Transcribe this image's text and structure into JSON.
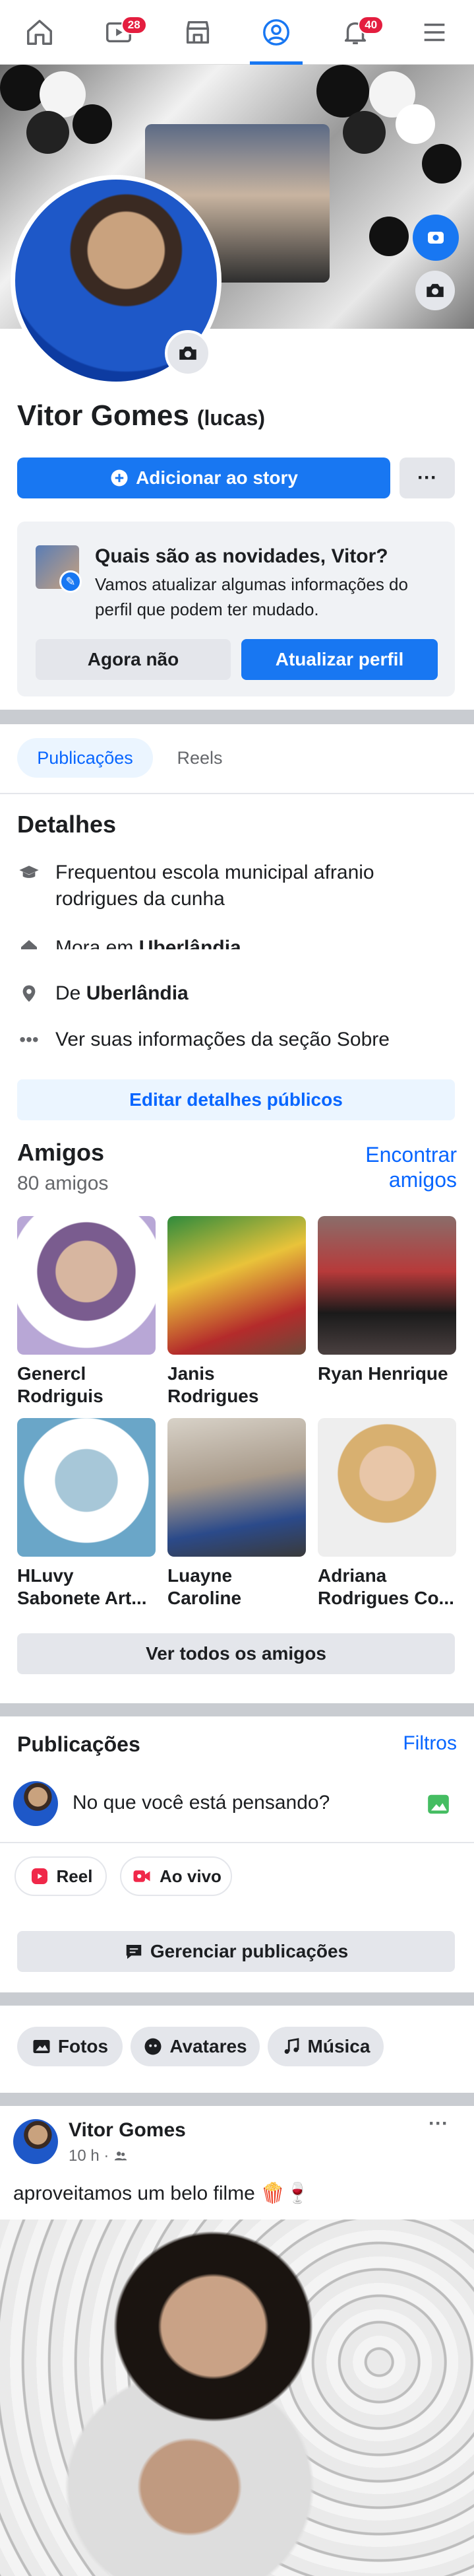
{
  "nav": {
    "notifications_badge": "28",
    "alerts_badge": "40",
    "accent": "#1877f2"
  },
  "profile": {
    "name": "Vitor Gomes",
    "nickname": "(lucas)",
    "add_story": "Adicionar ao story",
    "more": "···"
  },
  "update_card": {
    "title": "Quais são as novidades, Vitor?",
    "subtitle": "Vamos atualizar algumas informações do perfil que podem ter mudado.",
    "not_now": "Agora não",
    "update": "Atualizar perfil"
  },
  "tabs": [
    {
      "label": "Publicações",
      "active": true
    },
    {
      "label": "Reels",
      "active": false
    }
  ],
  "details": {
    "title": "Detalhes",
    "items": [
      {
        "icon": "graduation-cap-icon",
        "text": "Frequentou escola municipal afranio rodrigues da cunha"
      },
      {
        "icon": "home-icon",
        "text_prefix": "Mora em",
        "text_bold": "Uberlândia"
      },
      {
        "icon": "location-pin-icon",
        "text_prefix": "De",
        "text_bold": "Uberlândia"
      },
      {
        "icon": "more-dots-icon",
        "text": "Ver suas informações da seção Sobre"
      }
    ],
    "edit_button": "Editar detalhes públicos"
  },
  "friends": {
    "title": "Amigos",
    "count": "80 amigos",
    "find": "Encontrar amigos",
    "list": [
      {
        "name": "Genercl Rodriguis"
      },
      {
        "name": "Janis Rodrigues"
      },
      {
        "name": "Ryan Henrique"
      },
      {
        "name": "HLuvy Sabonete Art..."
      },
      {
        "name": "Luayne Caroline"
      },
      {
        "name": "Adriana Rodrigues Co..."
      }
    ],
    "see_all": "Ver todos os amigos"
  },
  "posts": {
    "title": "Publicações",
    "filters": "Filtros",
    "composer_placeholder": "No que você está pensando?",
    "reel": "Reel",
    "live": "Ao vivo",
    "manage": "Gerenciar publicações"
  },
  "media_chips": [
    "Fotos",
    "Avatares",
    "Música"
  ],
  "post": {
    "author": "Vitor Gomes",
    "time": "10 h ·",
    "caption": "aproveitamos um belo filme 🍿🍷",
    "menu": "···"
  }
}
